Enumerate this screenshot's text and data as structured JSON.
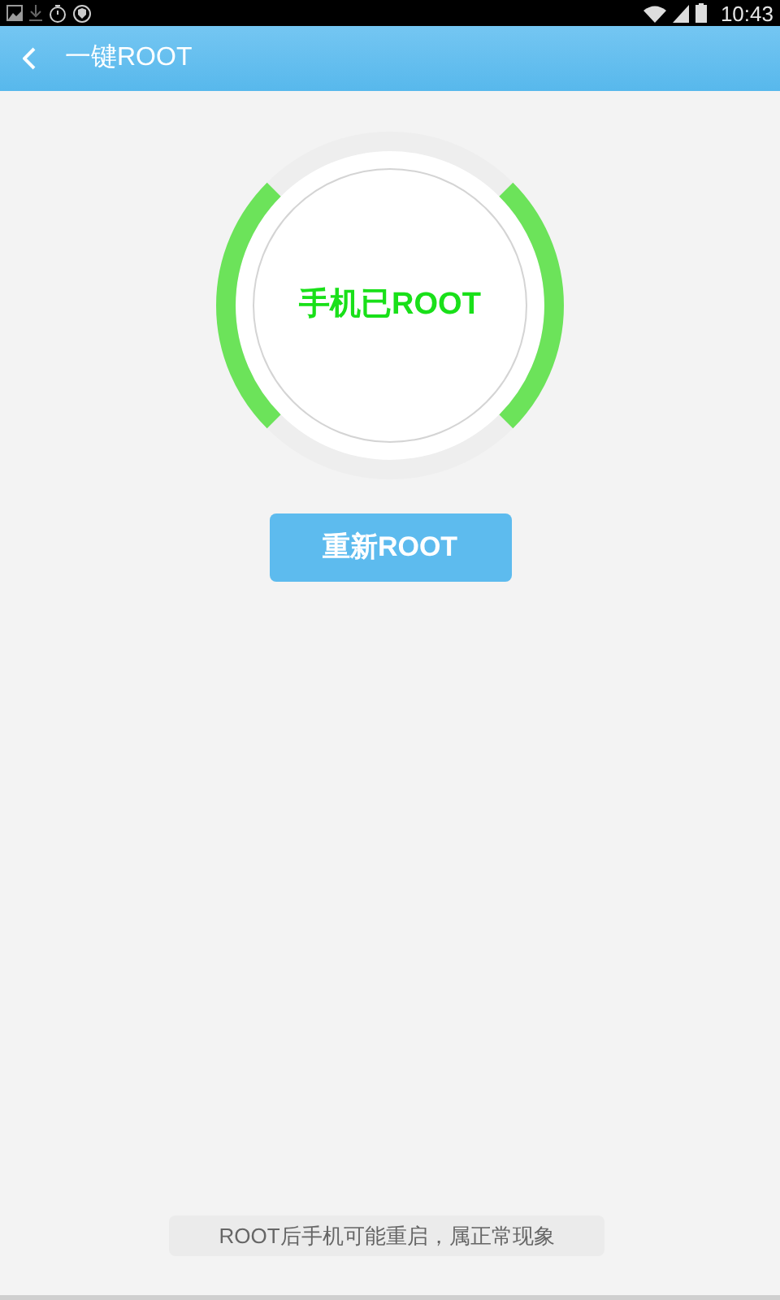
{
  "status_bar": {
    "time": "10:43"
  },
  "header": {
    "title": "一键ROOT"
  },
  "status": {
    "label": "手机已ROOT"
  },
  "button": {
    "label": "重新ROOT"
  },
  "toast": {
    "text": "ROOT后手机可能重启，属正常现象"
  }
}
